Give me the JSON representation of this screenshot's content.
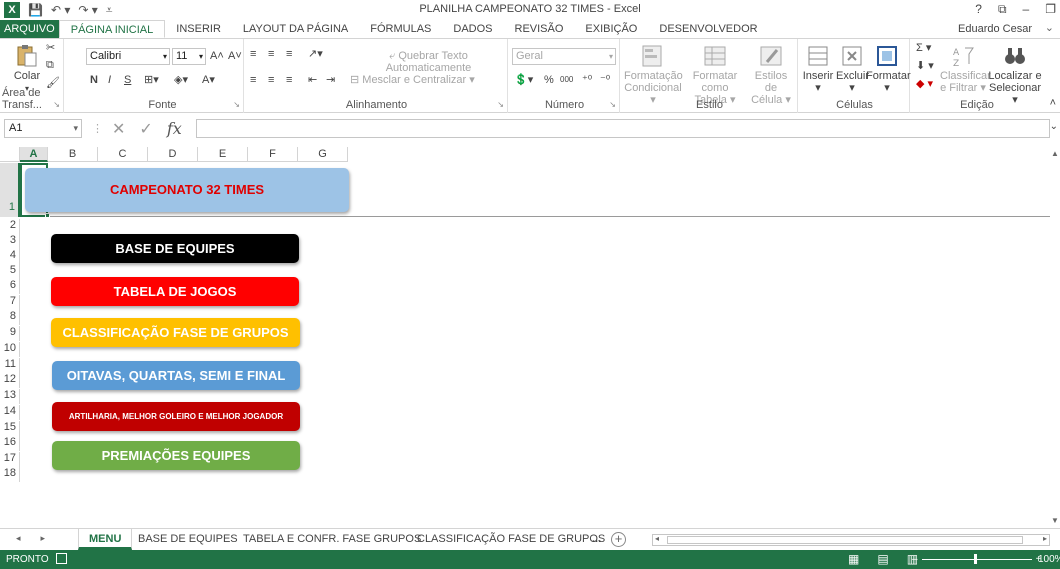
{
  "window": {
    "title": "PLANILHA CAMPEONATO 32 TIMES - Excel",
    "app_icon": "excel-logo-icon",
    "controls": [
      "?",
      "⧉",
      "–",
      "❐"
    ]
  },
  "ribbon_tabs": [
    "ARQUIVO",
    "PÁGINA INICIAL",
    "INSERIR",
    "LAYOUT DA PÁGINA",
    "FÓRMULAS",
    "DADOS",
    "REVISÃO",
    "EXIBIÇÃO",
    "DESENVOLVEDOR"
  ],
  "active_tab": "PÁGINA INICIAL",
  "user": "Eduardo Cesar",
  "ribbon": {
    "clipboard": {
      "label": "Área de Transf...",
      "paste": "Colar"
    },
    "font": {
      "label": "Fonte",
      "font_name": "Calibri",
      "font_size": "11",
      "bold": "N",
      "italic": "I",
      "underline": "S"
    },
    "alignment": {
      "label": "Alinhamento",
      "wrap": "Quebrar Texto Automaticamente",
      "merge": "Mesclar e Centralizar"
    },
    "number": {
      "label": "Número",
      "format": "Geral",
      "percent": "%",
      "thousands": "000"
    },
    "styles": {
      "label": "Estilo",
      "cond_format_1": "Formatação",
      "cond_format_2": "Condicional",
      "format_table_1": "Formatar como",
      "format_table_2": "Tabela",
      "cell_styles_1": "Estilos de",
      "cell_styles_2": "Célula"
    },
    "cells": {
      "label": "Células",
      "insert": "Inserir",
      "delete": "Excluir",
      "format": "Formatar"
    },
    "editing": {
      "label": "Edição",
      "sort_1": "Classificar",
      "sort_2": "e Filtrar",
      "find_1": "Localizar e",
      "find_2": "Selecionar"
    }
  },
  "formula_bar": {
    "name_box": "A1",
    "fx": "fx",
    "value": ""
  },
  "columns": [
    "A",
    "B",
    "C",
    "D",
    "E",
    "F",
    "G"
  ],
  "rows": [
    "1",
    "2",
    "3",
    "4",
    "5",
    "6",
    "7",
    "8",
    "9",
    "10",
    "11",
    "12",
    "13",
    "14",
    "15",
    "16",
    "17",
    "18"
  ],
  "menu": {
    "title": "CAMPEONATO 32 TIMES",
    "buttons": [
      {
        "label": "BASE DE EQUIPES",
        "bg": "#000000",
        "fg": "#FFFFFF"
      },
      {
        "label": "TABELA DE JOGOS",
        "bg": "#FF0000",
        "fg": "#FFFFFF"
      },
      {
        "label": "CLASSIFICAÇÃO FASE DE GRUPOS",
        "bg": "#FFC000",
        "fg": "#FFFFFF"
      },
      {
        "label": "OITAVAS, QUARTAS, SEMI E FINAL",
        "bg": "#5B9BD5",
        "fg": "#FFFFFF"
      },
      {
        "label": "ARTILHARIA, MELHOR GOLEIRO E MELHOR JOGADOR",
        "bg": "#C00000",
        "fg": "#FFFFFF"
      },
      {
        "label": "PREMIAÇÕES EQUIPES",
        "bg": "#70AD47",
        "fg": "#FFFFFF"
      }
    ]
  },
  "sheet_tabs": [
    "MENU",
    "BASE DE EQUIPES",
    "TABELA E CONFR. FASE GRUPOS",
    "CLASSIFICAÇÃO FASE DE GRUPOS",
    "..."
  ],
  "active_sheet": "MENU",
  "status": {
    "ready": "PRONTO",
    "zoom": "100%"
  },
  "colors": {
    "excel_green": "#217346",
    "title_button_bg": "#9DC3E6",
    "title_button_fg": "#E00000"
  }
}
